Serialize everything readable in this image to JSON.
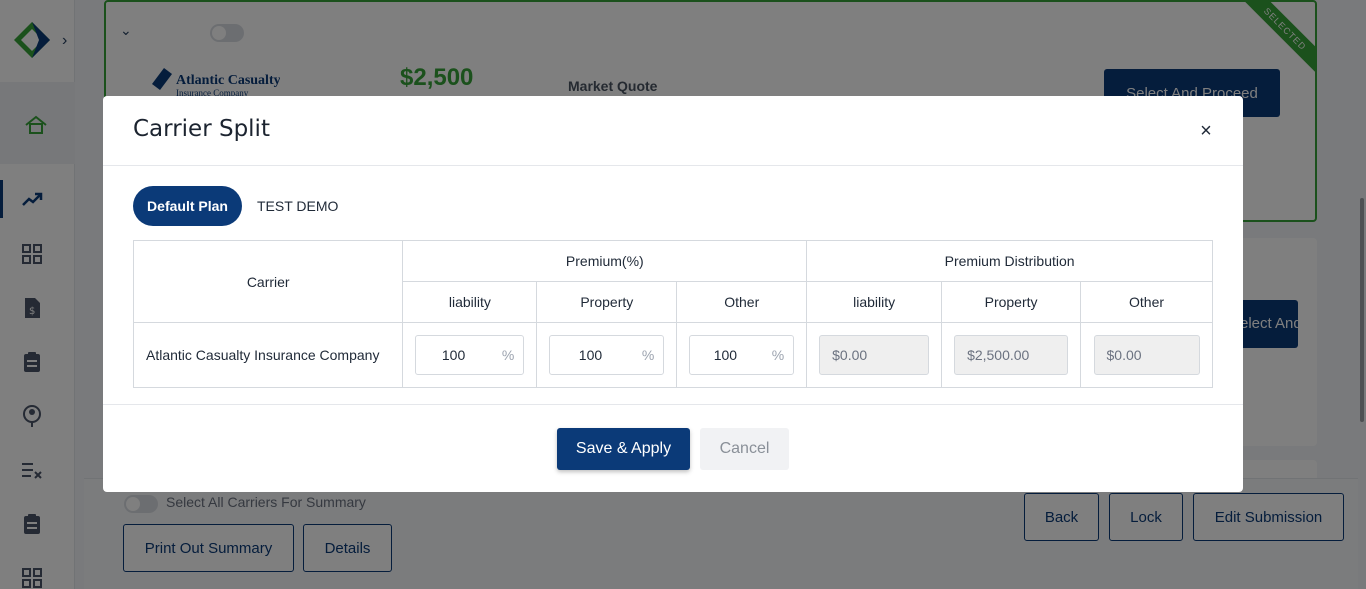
{
  "background": {
    "card1": {
      "carrier_logo_text": "Atlantic Casualty",
      "carrier_logo_subtext": "Insurance Company",
      "price": "$2,500",
      "quote_type": "Market Quote",
      "proceed_label": "Select And Proceed",
      "ribbon": "SELECTED"
    },
    "card2": {
      "button_fragment": "Select And Proceed"
    },
    "bottom": {
      "select_all_label": "Select All Carriers For Summary",
      "print_label": "Print Out Summary",
      "details_label": "Details",
      "back_label": "Back",
      "lock_label": "Lock",
      "edit_label": "Edit Submission"
    }
  },
  "modal": {
    "title": "Carrier Split",
    "close_symbol": "×",
    "tabs": [
      {
        "label": "Default Plan",
        "active": true
      },
      {
        "label": "TEST DEMO",
        "active": false
      }
    ],
    "table": {
      "carrier_header": "Carrier",
      "premium_pct_header": "Premium(%)",
      "premium_dist_header": "Premium Distribution",
      "sub_headers": [
        "liability",
        "Property",
        "Other",
        "liability",
        "Property",
        "Other"
      ],
      "rows": [
        {
          "carrier": "Atlantic Casualty Insurance Company",
          "pct_liability": "100",
          "pct_property": "100",
          "pct_other": "100",
          "pct_suffix": "%",
          "dist_liability": "$0.00",
          "dist_property": "$2,500.00",
          "dist_other": "$0.00"
        }
      ]
    },
    "save_label": "Save & Apply",
    "cancel_label": "Cancel"
  },
  "colors": {
    "primary": "#0b3a78",
    "accent_green": "#37a238"
  }
}
